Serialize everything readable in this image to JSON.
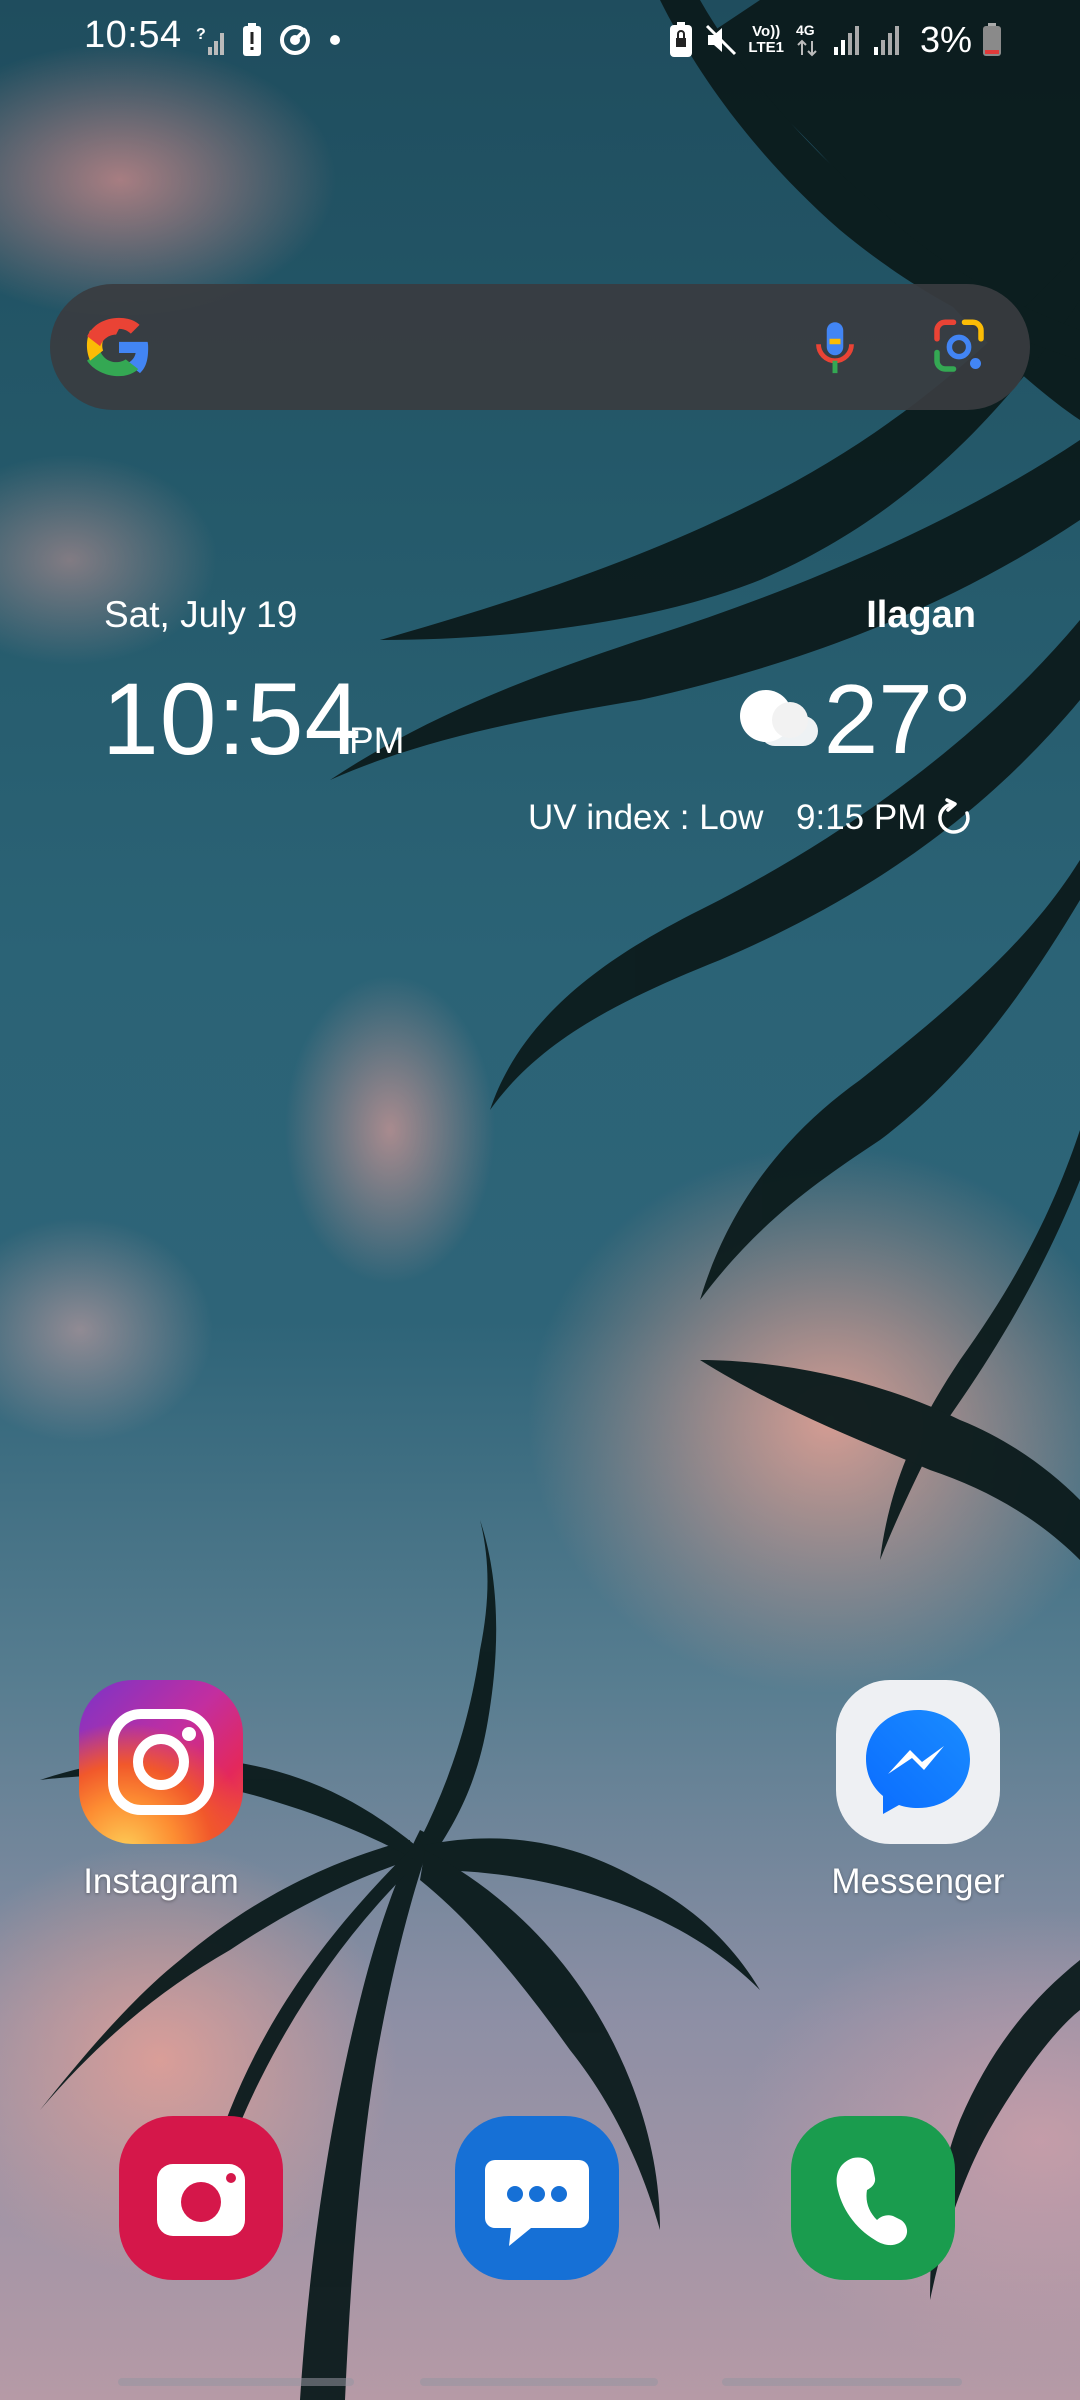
{
  "status_bar": {
    "time": "10:54",
    "battery_percent": "3%",
    "volte_label": "Vo))\nLTE1",
    "network_type": "4G",
    "left_icons": [
      "signal-unknown-icon",
      "battery-alert-icon",
      "focus-mode-icon",
      "notification-dot-icon"
    ],
    "right_icons": [
      "lock-battery-icon",
      "mute-icon",
      "volte-icon",
      "network-4g-icon",
      "signal-icon",
      "signal-icon-2",
      "battery-low-icon"
    ]
  },
  "search_bar": {
    "icons": [
      "google-logo",
      "mic-icon",
      "lens-icon"
    ]
  },
  "widget": {
    "date": "Sat, July 19",
    "time": "10:54",
    "ampm": "PM",
    "location": "Ilagan",
    "temperature": "27°",
    "uv_index": "UV index : Low",
    "updated_time": "9:15 PM",
    "weather_icon": "partly-cloudy-night-icon"
  },
  "apps": [
    {
      "label": "Instagram",
      "icon": "instagram-icon"
    },
    {
      "label": "Messenger",
      "icon": "messenger-icon"
    }
  ],
  "dock": [
    {
      "icon": "camera-icon"
    },
    {
      "icon": "messages-icon"
    },
    {
      "icon": "phone-icon"
    }
  ],
  "colors": {
    "camera": "#d5174a",
    "messages": "#1670d6",
    "phone": "#1a9c4e",
    "search_bar": "#3a3c40"
  }
}
